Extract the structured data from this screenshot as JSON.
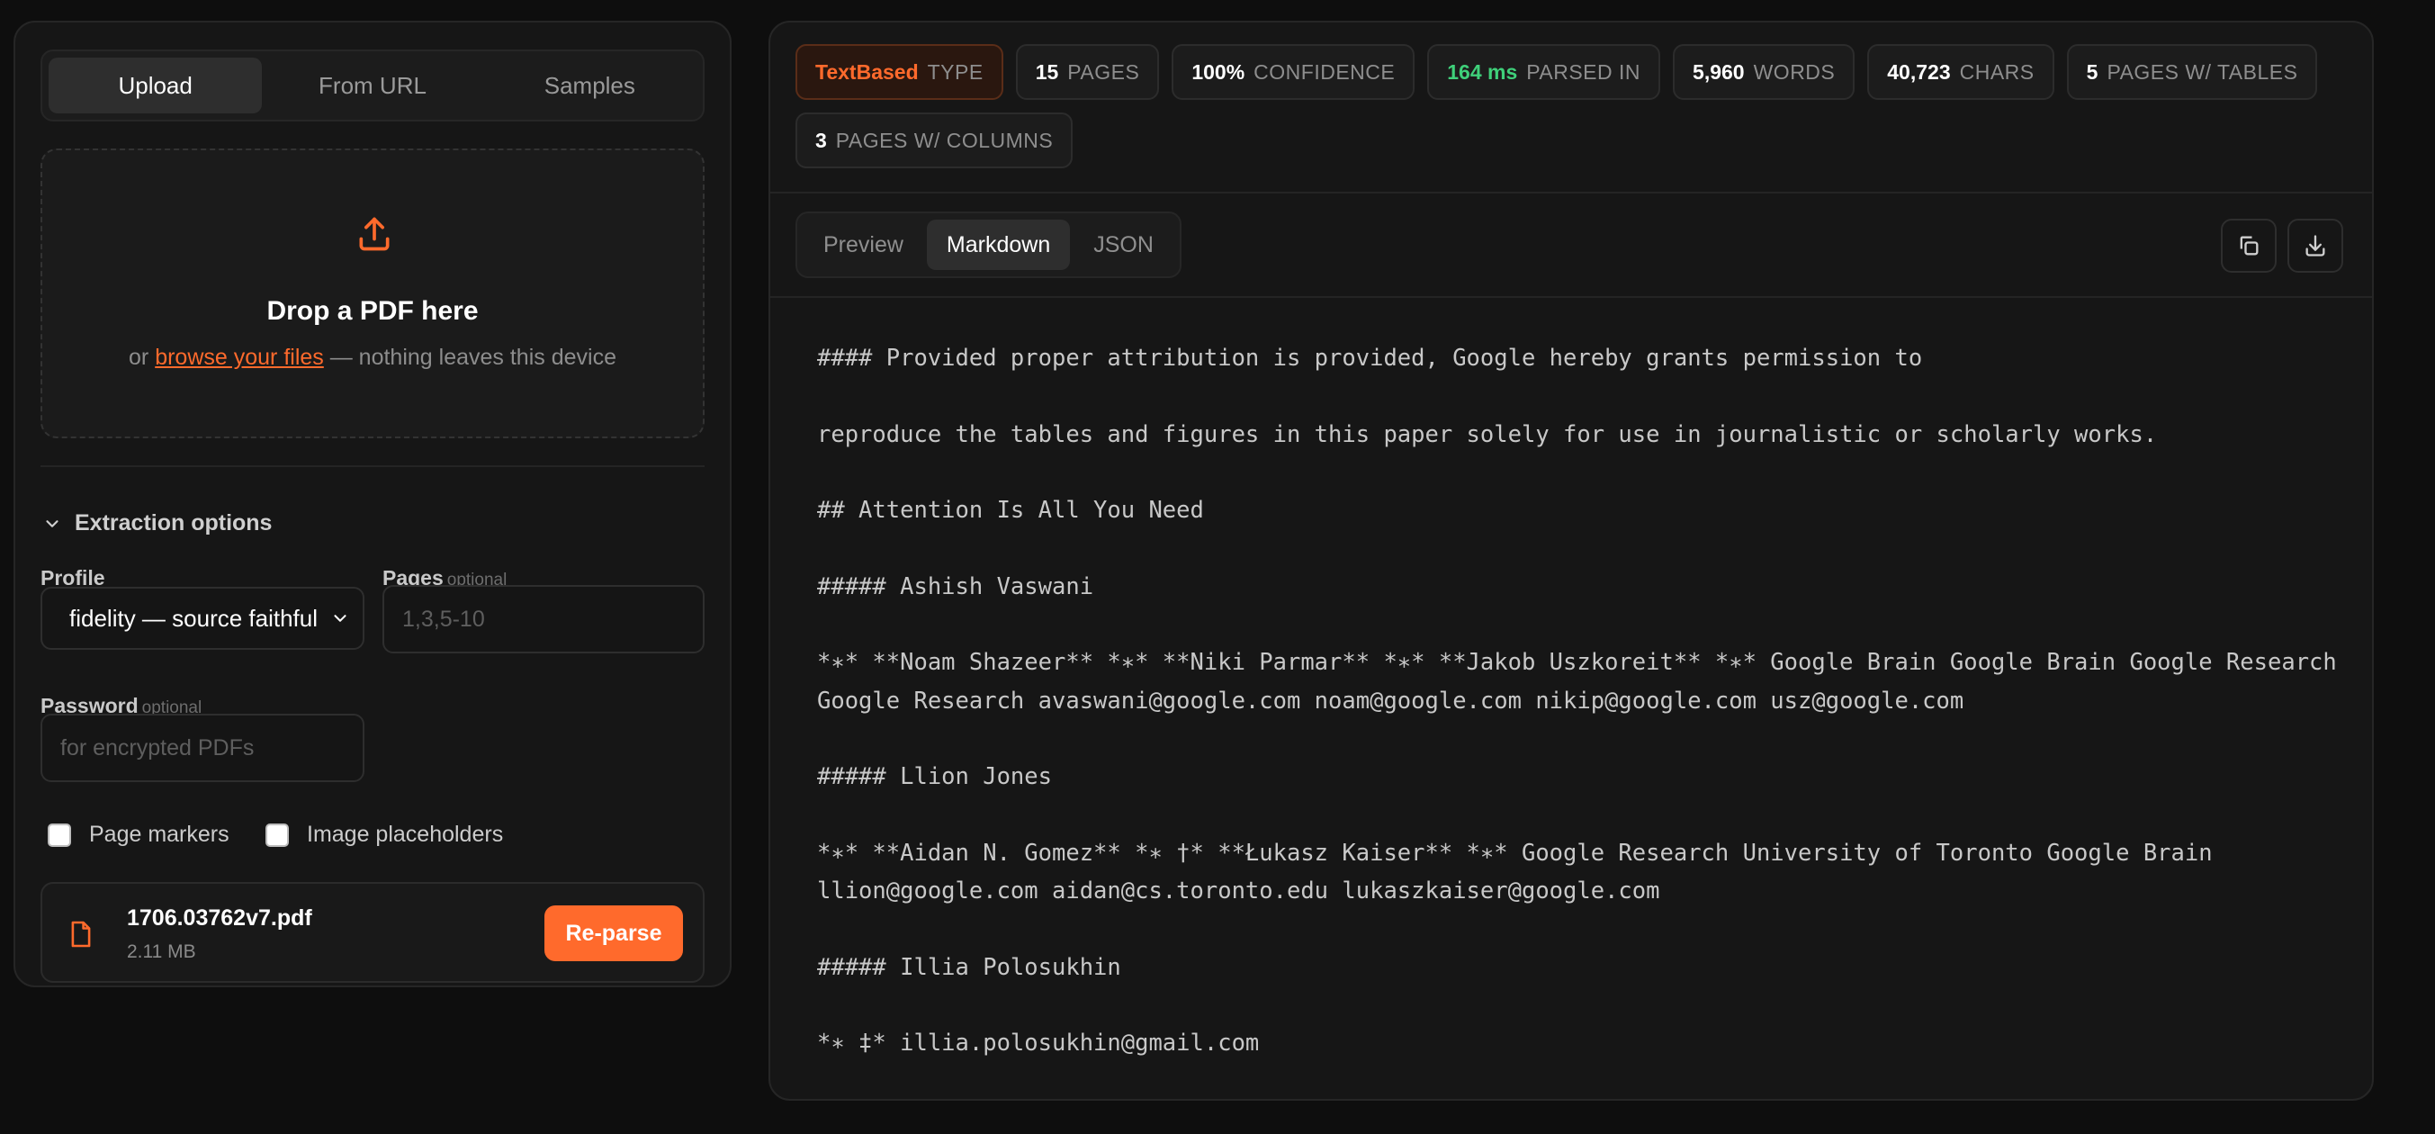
{
  "left_panel": {
    "tabs": [
      {
        "label": "Upload",
        "active": true
      },
      {
        "label": "From URL",
        "active": false
      },
      {
        "label": "Samples",
        "active": false
      }
    ],
    "dropzone": {
      "icon": "upload-icon",
      "title": "Drop a PDF here",
      "prefix": "or",
      "browse_link": "browse your files",
      "suffix": "— nothing leaves this device"
    },
    "extraction_options": {
      "label": "Extraction options",
      "profile_label": "Profile",
      "profile_value": "fidelity — source faithful",
      "pages_label": "Pages",
      "pages_optional": "optional",
      "pages_placeholder": "1,3,5-10",
      "password_label": "Password",
      "password_optional": "optional",
      "password_placeholder": "for encrypted PDFs",
      "checkboxes": [
        {
          "label": "Page markers",
          "checked": false
        },
        {
          "label": "Image placeholders",
          "checked": false
        }
      ]
    },
    "file": {
      "name": "1706.03762v7.pdf",
      "size": "2.11 MB",
      "reparse_label": "Re-parse"
    }
  },
  "stats": {
    "type": {
      "value": "TextBased",
      "label": "TYPE"
    },
    "pages": {
      "value": "15",
      "label": "PAGES"
    },
    "confidence": {
      "value": "100%",
      "label": "CONFIDENCE"
    },
    "parsed_in": {
      "value": "164 ms",
      "label": "PARSED IN"
    },
    "words": {
      "value": "5,960",
      "label": "WORDS"
    },
    "chars": {
      "value": "40,723",
      "label": "CHARS"
    },
    "pages_tables": {
      "value": "5",
      "label": "PAGES W/ TABLES"
    },
    "pages_columns": {
      "value": "3",
      "label": "PAGES W/ COLUMNS"
    }
  },
  "view_tabs": [
    {
      "label": "Preview",
      "active": false
    },
    {
      "label": "Markdown",
      "active": true
    },
    {
      "label": "JSON",
      "active": false
    }
  ],
  "actions": {
    "copy_icon": "copy-icon",
    "download_icon": "download-icon"
  },
  "markdown_lines": [
    "#### Provided proper attribution is provided, Google hereby grants permission to",
    "reproduce the tables and figures in this paper solely for use in journalistic or scholarly works.",
    "## Attention Is All You Need",
    "##### Ashish Vaswani",
    "*∗* **Noam Shazeer** *∗* **Niki Parmar** *∗* **Jakob Uszkoreit** *∗* Google Brain Google Brain Google Research Google Research avaswani@google.com noam@google.com nikip@google.com usz@google.com",
    "##### Llion Jones",
    "*∗* **Aidan N. Gomez** *∗ †* **Łukasz Kaiser** *∗* Google Research University of Toronto Google Brain llion@google.com aidan@cs.toronto.edu lukaszkaiser@google.com",
    "##### Illia Polosukhin",
    "*∗ ‡* illia.polosukhin@gmail.com"
  ],
  "colors": {
    "accent": "#ff6a2c",
    "success": "#3fd07a",
    "background": "#0e0e0e",
    "panel": "#161616"
  }
}
